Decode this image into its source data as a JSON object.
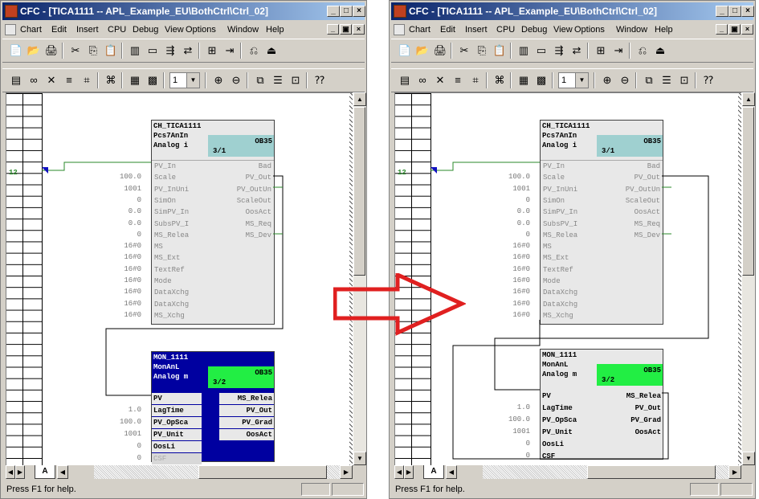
{
  "window": {
    "title": "CFC - [TICA1111 -- APL_Example_EU\\BothCtrl\\Ctrl_02]",
    "title_buttons": [
      "_",
      "□",
      "×"
    ],
    "menu_buttons": [
      "_",
      "▣",
      "×"
    ]
  },
  "menu": [
    "Chart",
    "Edit",
    "Insert",
    "CPU",
    "Debug",
    "View",
    "Options",
    "Window",
    "Help"
  ],
  "toolbar2": {
    "zoom_value": "1"
  },
  "status_text": "Press F1 for help.",
  "sheet_tab": "A",
  "canvas_row_label": "12",
  "block1": {
    "name": "CH_TICA1111",
    "type": "Pcs7AnIn",
    "desc": "Analog i",
    "ob": "OB35",
    "index": "3/1",
    "inputs": [
      {
        "label": "PV_In",
        "value": ""
      },
      {
        "label": "Scale",
        "value": "100.0"
      },
      {
        "label": "PV_InUni",
        "value": "1001"
      },
      {
        "label": "SimOn",
        "value": "0"
      },
      {
        "label": "SimPV_In",
        "value": "0.0"
      },
      {
        "label": "SubsPV_I",
        "value": "0.0"
      },
      {
        "label": "MS_Relea",
        "value": "0"
      },
      {
        "label": "MS",
        "value": "16#0"
      },
      {
        "label": "MS_Ext",
        "value": "16#0"
      },
      {
        "label": "TextRef",
        "value": "16#0"
      },
      {
        "label": "Mode",
        "value": "16#0"
      },
      {
        "label": "DataXchg",
        "value": "16#0"
      },
      {
        "label": "DataXchg",
        "value": "16#0"
      },
      {
        "label": "MS_Xchg",
        "value": "16#0"
      }
    ],
    "outputs": [
      "Bad",
      "PV_Out",
      "PV_OutUn",
      "ScaleOut",
      "OosAct",
      "MS_Req",
      "MS_Dev"
    ]
  },
  "block2": {
    "name": "MON_1111",
    "type": "MonAnL",
    "desc": "Analog m",
    "ob": "OB35",
    "index": "3/2",
    "inputs": [
      {
        "label": "PV",
        "value": ""
      },
      {
        "label": "LagTime",
        "value": "1.0"
      },
      {
        "label": "PV_OpSca",
        "value": "100.0"
      },
      {
        "label": "PV_Unit",
        "value": "1001"
      },
      {
        "label": "OosLi",
        "value": "0"
      },
      {
        "label": "CSF",
        "value": "0"
      }
    ],
    "outputs": [
      "MS_Relea",
      "PV_Out",
      "PV_Grad",
      "OosAct"
    ]
  },
  "colors": {
    "titlebar_start": "#0a246a",
    "ob_teal": "#9fd0d0",
    "ob_green": "#22ee44",
    "selected_block": "#0000a0",
    "arrow_red": "#e02020"
  }
}
